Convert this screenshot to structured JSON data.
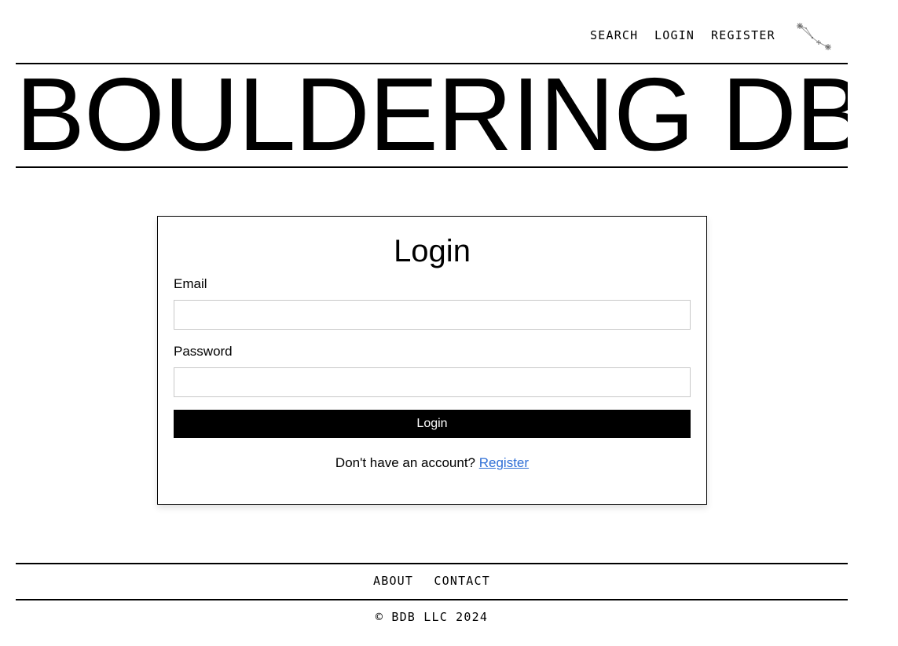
{
  "nav": {
    "search_label": "SEARCH",
    "login_label": "LOGIN",
    "register_label": "REGISTER",
    "logo_icon": "constellation-icon"
  },
  "header": {
    "title": "BOULDERING DB"
  },
  "login_form": {
    "title": "Login",
    "email_label": "Email",
    "email_value": "",
    "email_placeholder": "",
    "password_label": "Password",
    "password_value": "",
    "password_placeholder": "",
    "submit_label": "Login",
    "register_prompt": "Don't have an account?",
    "register_link": "Register"
  },
  "footer": {
    "about_label": "ABOUT",
    "contact_label": "CONTACT",
    "copyright": "© BDB LLC 2024"
  },
  "colors": {
    "background": "#ffffff",
    "text": "#000000",
    "button_bg": "#000000",
    "button_text": "#ffffff",
    "link": "#2f6fd6",
    "input_border": "#c8c8c8"
  }
}
